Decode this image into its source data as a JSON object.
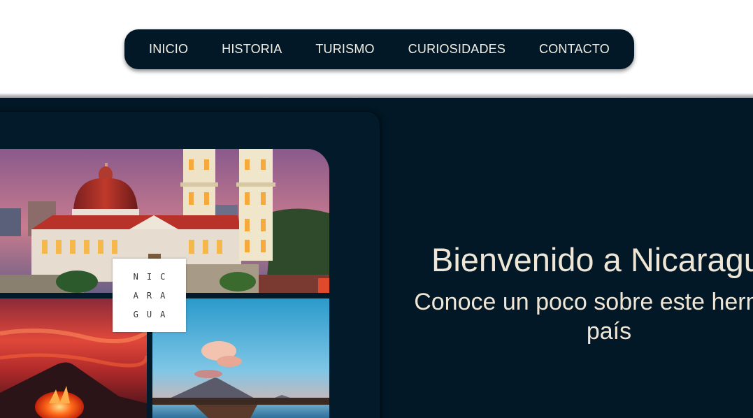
{
  "nav": {
    "items": [
      {
        "label": "INICIO"
      },
      {
        "label": "HISTORIA"
      },
      {
        "label": "TURISMO"
      },
      {
        "label": "CURIOSIDADES"
      },
      {
        "label": "CONTACTO"
      }
    ]
  },
  "hero": {
    "title": "Bienvenido a Nicaragua",
    "subtitle": "Conoce un poco sobre este hermoso país"
  },
  "badge": {
    "lines": [
      "NIC",
      "ARA",
      "GUA"
    ]
  },
  "colors": {
    "background_dark": "#021826",
    "text_light": "#efe6d6",
    "nav_text": "#f2f0e6"
  }
}
